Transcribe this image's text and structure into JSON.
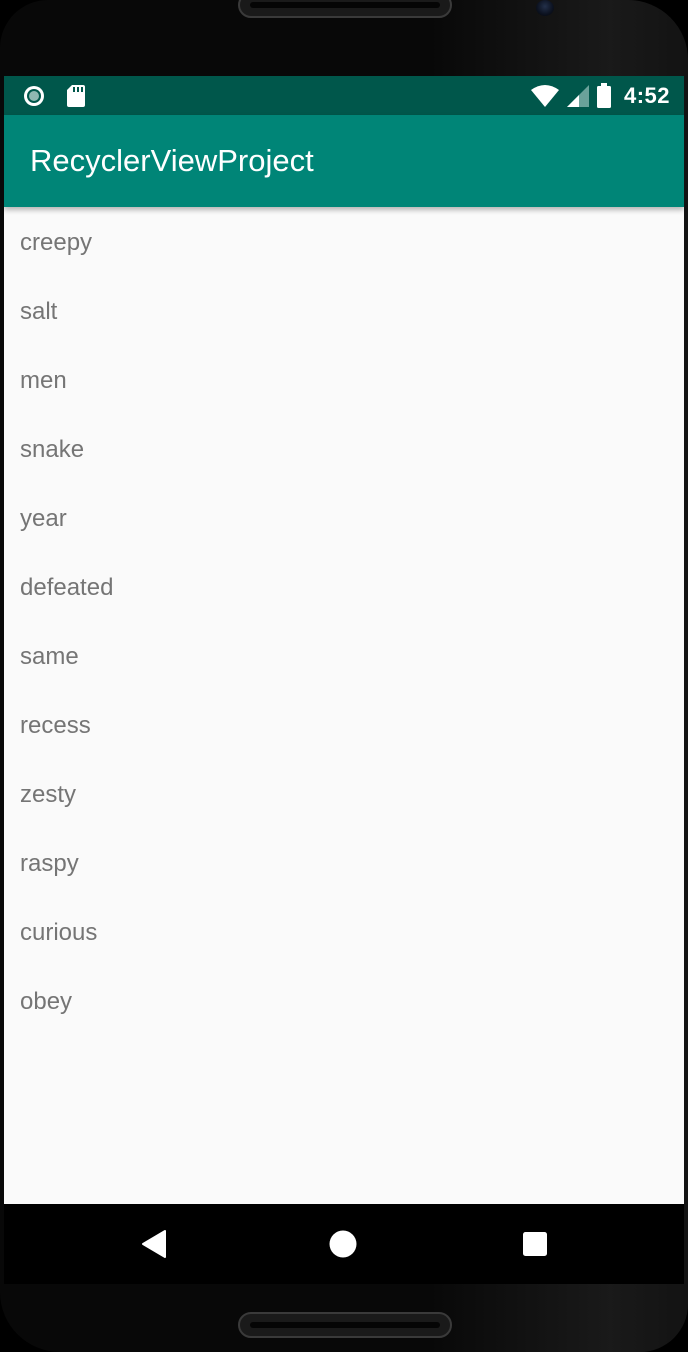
{
  "status_bar": {
    "left_icons": [
      "notification-circle-icon",
      "sd-card-icon"
    ],
    "right_icons": [
      "wifi-icon",
      "cell-signal-icon",
      "battery-icon"
    ],
    "time": "4:52"
  },
  "app_bar": {
    "title": "RecyclerViewProject",
    "color": "#008577"
  },
  "list": {
    "items": [
      "creepy",
      "salt",
      "men",
      "snake",
      "year",
      "defeated",
      "same",
      "recess",
      "zesty",
      "raspy",
      "curious",
      "obey"
    ]
  },
  "nav_bar": {
    "buttons": [
      "back-icon",
      "home-icon",
      "recents-icon"
    ]
  },
  "colors": {
    "status_bar": "#00574b",
    "app_bar": "#008577",
    "background": "#fafafa",
    "item_text": "#757575"
  }
}
